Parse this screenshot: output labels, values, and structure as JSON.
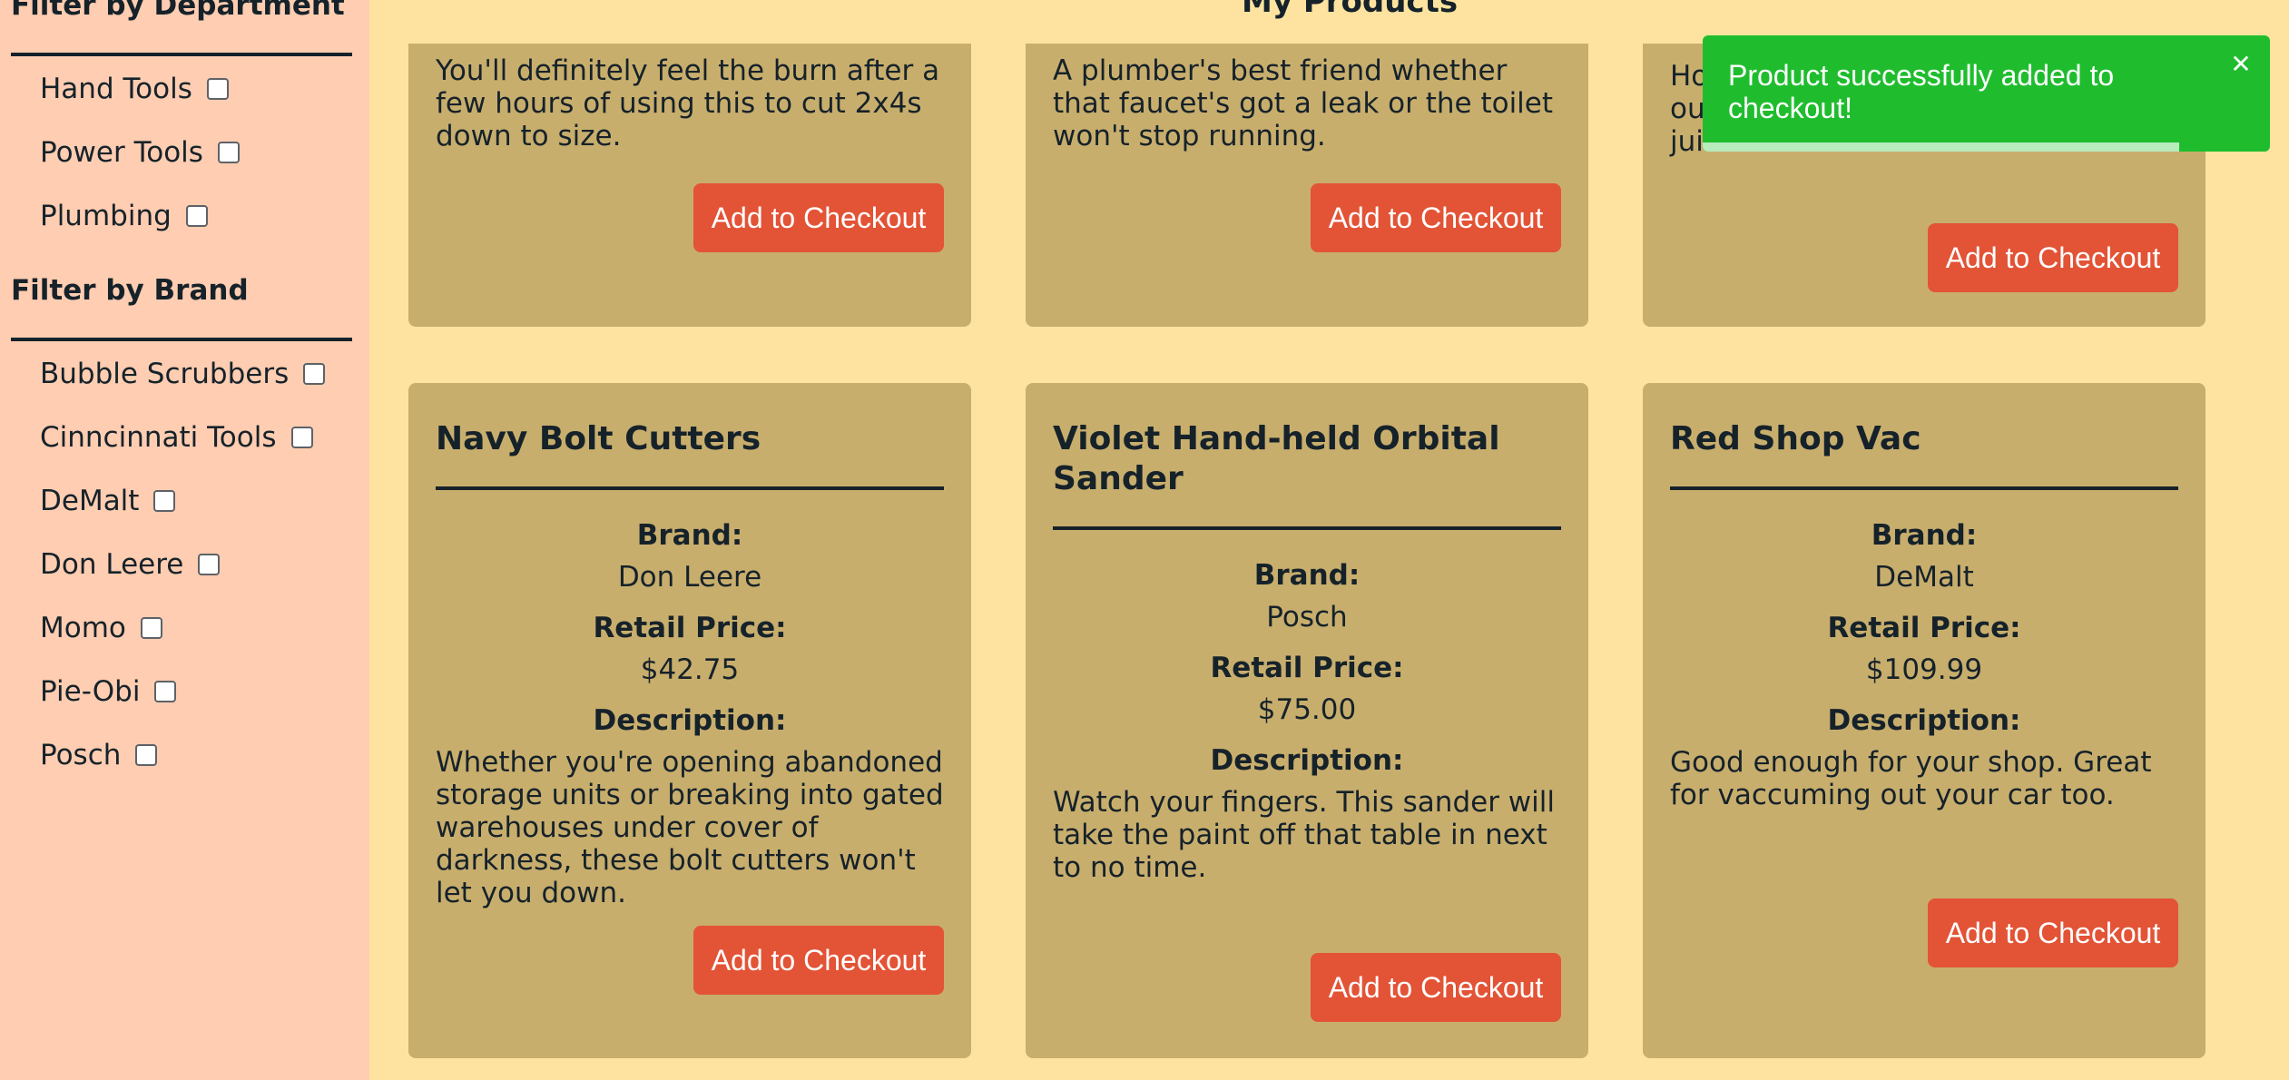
{
  "sidebar": {
    "department_heading": "Filter by Department",
    "departments": [
      {
        "label": "Hand Tools",
        "checked": false
      },
      {
        "label": "Power Tools",
        "checked": false
      },
      {
        "label": "Plumbing",
        "checked": false
      }
    ],
    "brand_heading": "Filter by Brand",
    "brands": [
      {
        "label": "Bubble Scrubbers",
        "checked": false
      },
      {
        "label": "Cinncinnati Tools",
        "checked": false
      },
      {
        "label": "DeMalt",
        "checked": false
      },
      {
        "label": "Don Leere",
        "checked": false
      },
      {
        "label": "Momo",
        "checked": false
      },
      {
        "label": "Pie-Obi",
        "checked": false
      },
      {
        "label": "Posch",
        "checked": false
      }
    ]
  },
  "main": {
    "title": "My Products",
    "field_labels": {
      "brand": "Brand:",
      "price": "Retail Price:",
      "description": "Description:"
    },
    "add_button_label": "Add to Checkout",
    "top_row": [
      {
        "description": "You'll definitely feel the burn after a few hours of using this to cut 2x4s down to size."
      },
      {
        "description": "A plumber's best friend whether that faucet's got a leak or the toilet won't stop running."
      },
      {
        "description": "Ho\nou\njui"
      }
    ],
    "products": [
      {
        "name": "Navy Bolt Cutters",
        "brand": "Don Leere",
        "price": "$42.75",
        "description": "Whether you're opening abandoned storage units or breaking into gated warehouses under cover of darkness, these bolt cutters won't let you down."
      },
      {
        "name": "Violet Hand-held Orbital Sander",
        "brand": "Posch",
        "price": "$75.00",
        "description": "Watch your fingers. This sander will take the paint off that table in next to no time."
      },
      {
        "name": "Red Shop Vac",
        "brand": "DeMalt",
        "price": "$109.99",
        "description": "Good enough for your shop. Great for vaccuming out your car too."
      }
    ]
  },
  "toast": {
    "message": "Product successfully added to checkout!",
    "close_icon": "close-icon",
    "progress_fraction": 0.84
  },
  "colors": {
    "page_background": "#fde39f",
    "sidebar_background": "#ffcdb1",
    "card_background": "#c8ae6d",
    "button_background": "#e35336",
    "toast_background": "#1fbd2e",
    "text": "#16222a"
  }
}
